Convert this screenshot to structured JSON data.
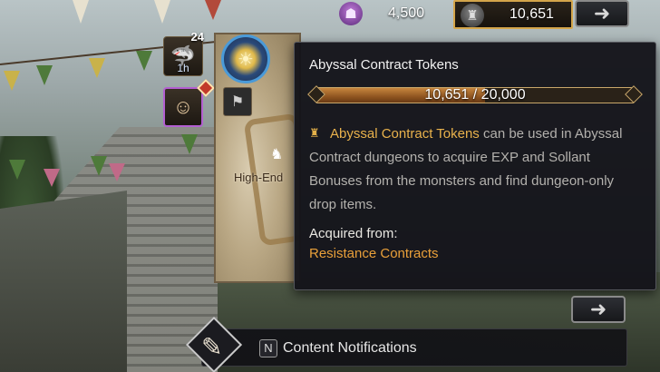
{
  "hud": {
    "silver_amount": "4,500",
    "abyssal_token_amount": "10,651",
    "hood_icon": "hooded-figure-icon",
    "token_icon": "abyssal-helm-icon",
    "top_arrow_glyph": "➜",
    "bottom_arrow_glyph": "➜"
  },
  "buffs": {
    "shark_count": "24",
    "shark_timer": "1h",
    "shark_icon": "shark-icon",
    "mask_icon": "mask-icon"
  },
  "minimap": {
    "label": "High-End"
  },
  "tooltip": {
    "title": "Abyssal Contract Tokens",
    "progress_text": "10,651 / 20,000",
    "progress_current": 10651,
    "progress_max": 20000,
    "desc_highlight": "Abyssal Contract Tokens",
    "desc_rest": " can be used in Abyssal Contract dungeons to acquire EXP and Sollant Bonuses from the monsters and find dungeon-only drop items.",
    "acquired_label": "Acquired from:",
    "acquired_source": "Resistance Contracts"
  },
  "notification": {
    "key": "N",
    "label": "Content Notifications"
  },
  "colors": {
    "accent_gold": "#e9b24c",
    "source_orange": "#e9a03a",
    "progress_fill": "#8f5520"
  }
}
